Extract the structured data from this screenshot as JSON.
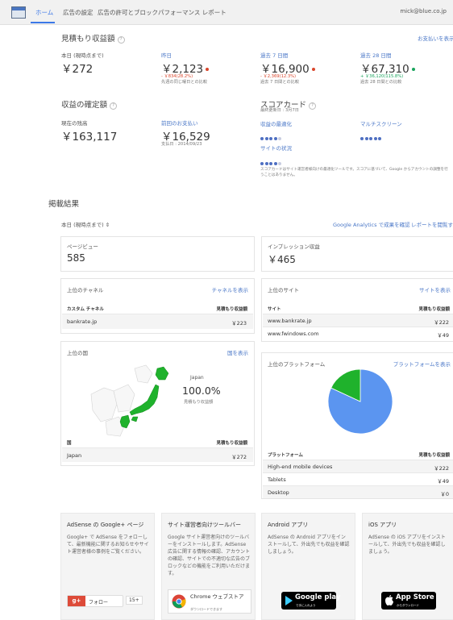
{
  "nav": {
    "tabs": [
      "ホーム",
      "広告の設定",
      "広告の許可とブロック",
      "パフォーマンス レポート"
    ],
    "email": "mick@blue.co.jp"
  },
  "earnings": {
    "title": "見積もり収益額",
    "payment_link": "お支払いを表示",
    "today": {
      "label": "本日 (現時点まで)",
      "value": "￥272"
    },
    "yesterday": {
      "label": "昨日",
      "value": "￥2,123",
      "change": "- ￥834(28.2%)",
      "compare": "先週の同じ曜日との比較",
      "trend_color": "#d9452b"
    },
    "last7": {
      "label": "過去 7 日間",
      "value": "￥16,900",
      "change": "- ￥2,369(12.3%)",
      "compare": "過去 7 日間との比較",
      "trend_color": "#d9452b"
    },
    "last28": {
      "label": "過去 28 日間",
      "value": "￥67,310",
      "change": "+ ￥36,120(115.8%)",
      "compare": "過去 28 日間との比較",
      "trend_color": "#19a35c"
    }
  },
  "finalized": {
    "title": "収益の確定額",
    "balance_label": "現在の残高",
    "balance_value": "￥163,117",
    "last_payment_label": "前回のお支払い",
    "last_payment_value": "￥16,529",
    "paid_date": "支払日 : 2014/09/23"
  },
  "scorecard": {
    "title": "スコアカード",
    "updated": "最終更新日 : 3月7日",
    "revenue_opt": {
      "label": "収益の最適化",
      "score": 4,
      "max": 5
    },
    "multiscreen": {
      "label": "マルチスクリーン",
      "score": 5,
      "max": 5
    },
    "site_health": {
      "label": "サイトの状況",
      "score": 4,
      "max": 5
    },
    "note": "スコアカードはサイト運営者様向けの最適化ツールです。スコアに基づいて、Google からアカウントの調整を行うことはありません。"
  },
  "results": {
    "title": "掲載結果",
    "range": "本日 (現時点まで)",
    "analytics_link": "Google Analytics で成果を確認",
    "report_link": "レポートを閲覧する",
    "pageviews": {
      "label": "ページビュー",
      "value": "585"
    },
    "impression_rev": {
      "label": "インプレッション収益",
      "value": "￥465"
    }
  },
  "channels": {
    "title": "上位のチャネル",
    "link": "チャネルを表示",
    "col1": "カスタム チャネル",
    "col2": "見積もり収益額",
    "rows": [
      {
        "name": "bankrate.jp",
        "value": "￥223"
      }
    ]
  },
  "sites": {
    "title": "上位のサイト",
    "link": "サイトを表示",
    "col1": "サイト",
    "col2": "見積もり収益額",
    "rows": [
      {
        "name": "www.bankrate.jp",
        "value": "￥222"
      },
      {
        "name": "www.fwindows.com",
        "value": "￥49"
      }
    ]
  },
  "countries": {
    "title": "上位の国",
    "link": "国を表示",
    "map_country": "Japan",
    "map_percent": "100.0%",
    "map_caption": "見積もり収益額",
    "col1": "国",
    "col2": "見積もり収益額",
    "rows": [
      {
        "name": "Japan",
        "value": "￥272"
      }
    ]
  },
  "platforms": {
    "title": "上位のプラットフォーム",
    "link": "プラットフォームを表示",
    "col1": "プラットフォーム",
    "col2": "見積もり収益額",
    "rows": [
      {
        "name": "High-end mobile devices",
        "value": "￥222"
      },
      {
        "name": "Tablets",
        "value": "￥49"
      },
      {
        "name": "Desktop",
        "value": "￥0"
      }
    ],
    "chart_colors": {
      "high_end_mobile": "#5b95f0",
      "tablets": "#1fb22c"
    }
  },
  "chart_data": {
    "type": "pie",
    "labels": [
      "High-end mobile devices",
      "Tablets",
      "Desktop"
    ],
    "values": [
      222,
      49,
      0
    ]
  },
  "promos": {
    "gplus": {
      "title": "AdSense の Google+ ページ",
      "text": "Google+ で AdSense をフォローして、最新機能に関するお知らせやサイト運営者様の事例をご覧ください。",
      "follow": "フォロー",
      "count": "15+"
    },
    "toolbar": {
      "title": "サイト運営者向けツールバー",
      "text": "Google サイト運営者向けのツールバーをインストールします。AdSense 広告に関する情報の確認、アカウントの確認、サイトでの不適切な広告のブロックなどの機能をご利用いただけます。",
      "store": "Chrome ウェブストア",
      "store_sub": "ダウンロードできます"
    },
    "android": {
      "title": "Android アプリ",
      "text": "AdSense の Android アプリをインストールして、外出先でも収益を確認しましょう。",
      "badge": "Google play",
      "badge_sub": "で手に入れよう"
    },
    "ios": {
      "title": "iOS アプリ",
      "text": "AdSense の iOS アプリをインストールして、外出先でも収益を確認しましょう。",
      "badge": "App Store",
      "badge_sub": "からダウンロード"
    }
  }
}
